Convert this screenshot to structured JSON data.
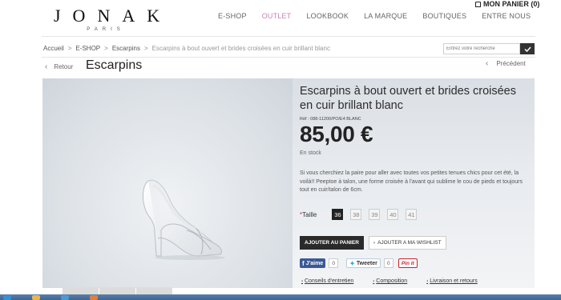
{
  "brand": {
    "name": "JONAK",
    "sub": "PARIS"
  },
  "cart": {
    "label": "MON PANIER (0)"
  },
  "nav": [
    {
      "label": "E-SHOP",
      "active": false
    },
    {
      "label": "OUTLET",
      "active": true
    },
    {
      "label": "LOOKBOOK",
      "active": false
    },
    {
      "label": "LA MARQUE",
      "active": false
    },
    {
      "label": "BOUTIQUES",
      "active": false
    },
    {
      "label": "ENTRE NOUS",
      "active": false
    }
  ],
  "breadcrumb": {
    "items": [
      "Accueil",
      "E-SHOP",
      "Escarpins"
    ],
    "current": "Escarpins à bout ouvert et brides croisées en cuir brillant blanc"
  },
  "search": {
    "placeholder": "Entrez votre recherche"
  },
  "title_row": {
    "back_label": "Retour",
    "title": "Escarpins",
    "prev_label": "Précédent"
  },
  "product": {
    "name": "Escarpins à bout ouvert et brides croisées en cuir brillant blanc",
    "ref": "Réf : 088-11200/PO/E4 BLANC",
    "price": "85,00 €",
    "stock": "En stock",
    "description": "Si vous cherchiez la paire pour aller avec toutes vos petites tenues chics pour cet été, la voilà!! Peeptoe à talon, une forme croisée à l'avant qui sublime le cou de pieds et toujours tout en cuir/talon de 6cm."
  },
  "sizes": {
    "label": "Taille",
    "required_mark": "*",
    "options": [
      "36",
      "38",
      "39",
      "40",
      "41"
    ],
    "selected": "36"
  },
  "actions": {
    "cart_label": "AJOUTER AU PANIER",
    "wishlist_label": "AJOUTER A MA WISHLIST"
  },
  "social": {
    "facebook_label": "J'aime",
    "facebook_count": "0",
    "twitter_label": "Tweeter",
    "twitter_count": "0",
    "pinterest_label": "Pin it"
  },
  "links": [
    "Conseils d'entretien",
    "Composition",
    "Livraison et retours"
  ],
  "colors": {
    "accent_outlet": "#c783b6",
    "dark": "#2a2a2a",
    "facebook": "#3b5998",
    "pinterest": "#cc2127"
  }
}
